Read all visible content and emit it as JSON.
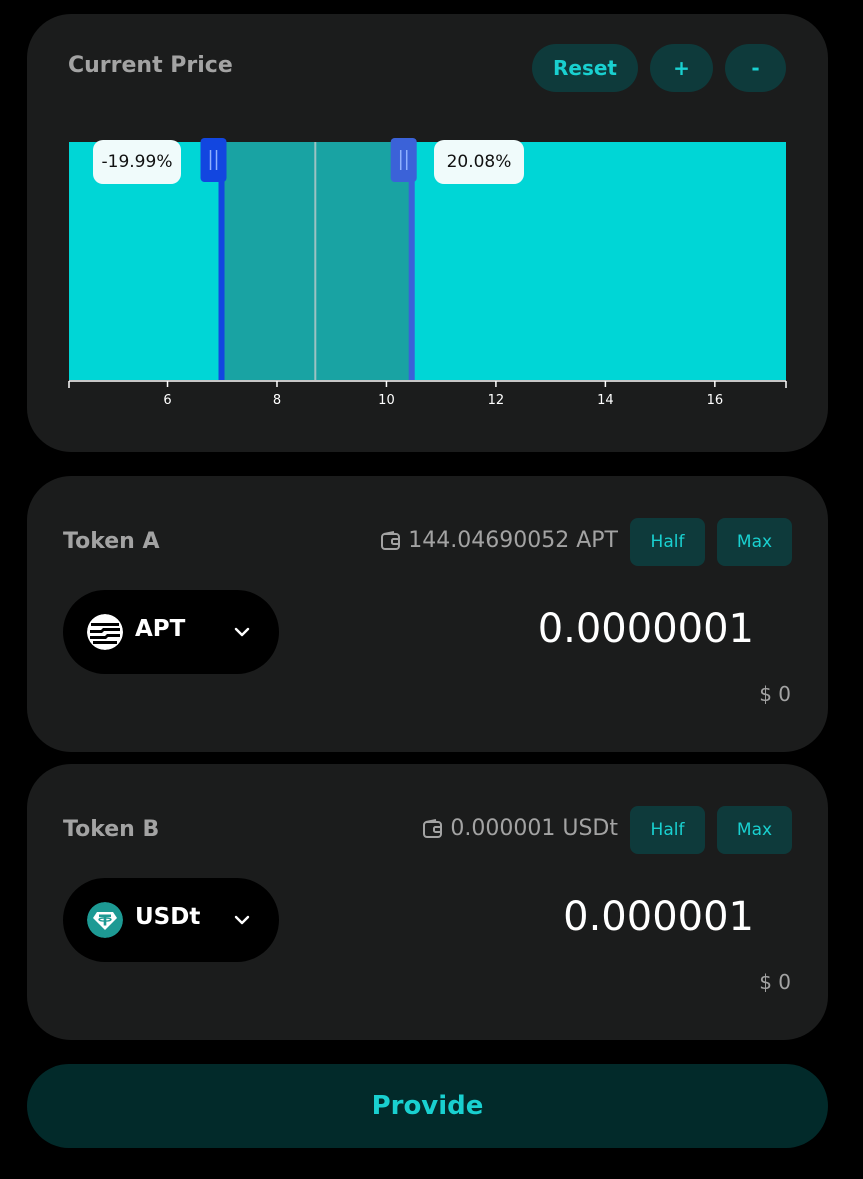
{
  "price_card": {
    "title": "Current Price",
    "reset_label": "Reset",
    "zoom_in_label": "+",
    "zoom_out_label": "-",
    "lower_pct": "-19.99%",
    "upper_pct": "20.08%"
  },
  "chart_data": {
    "type": "area",
    "xlim": [
      4.2,
      17.3
    ],
    "x_ticks": [
      6,
      8,
      10,
      12,
      14,
      16
    ],
    "current_price": 8.7,
    "range_lower": 6.95,
    "range_upper": 10.48,
    "colors": {
      "liquidity": "#00d6d6",
      "selected_range": "#19a3a3",
      "lower_handle": "#1246e0",
      "upper_handle": "#3b62d8",
      "current_price_line": "#9cc3c3"
    }
  },
  "token_a": {
    "title": "Token A",
    "balance": "144.04690052 APT",
    "half_label": "Half",
    "max_label": "Max",
    "symbol": "APT",
    "amount": "0.0000001",
    "usd_value": "$ 0"
  },
  "token_b": {
    "title": "Token B",
    "balance": "0.000001 USDt",
    "half_label": "Half",
    "max_label": "Max",
    "symbol": "USDt",
    "amount": "0.000001",
    "usd_value": "$ 0"
  },
  "provide_label": "Provide",
  "icons": {
    "wallet": "wallet-icon",
    "chevron": "chevron-down-icon",
    "apt": "apt-logo-icon",
    "usdt": "usdt-logo-icon"
  }
}
